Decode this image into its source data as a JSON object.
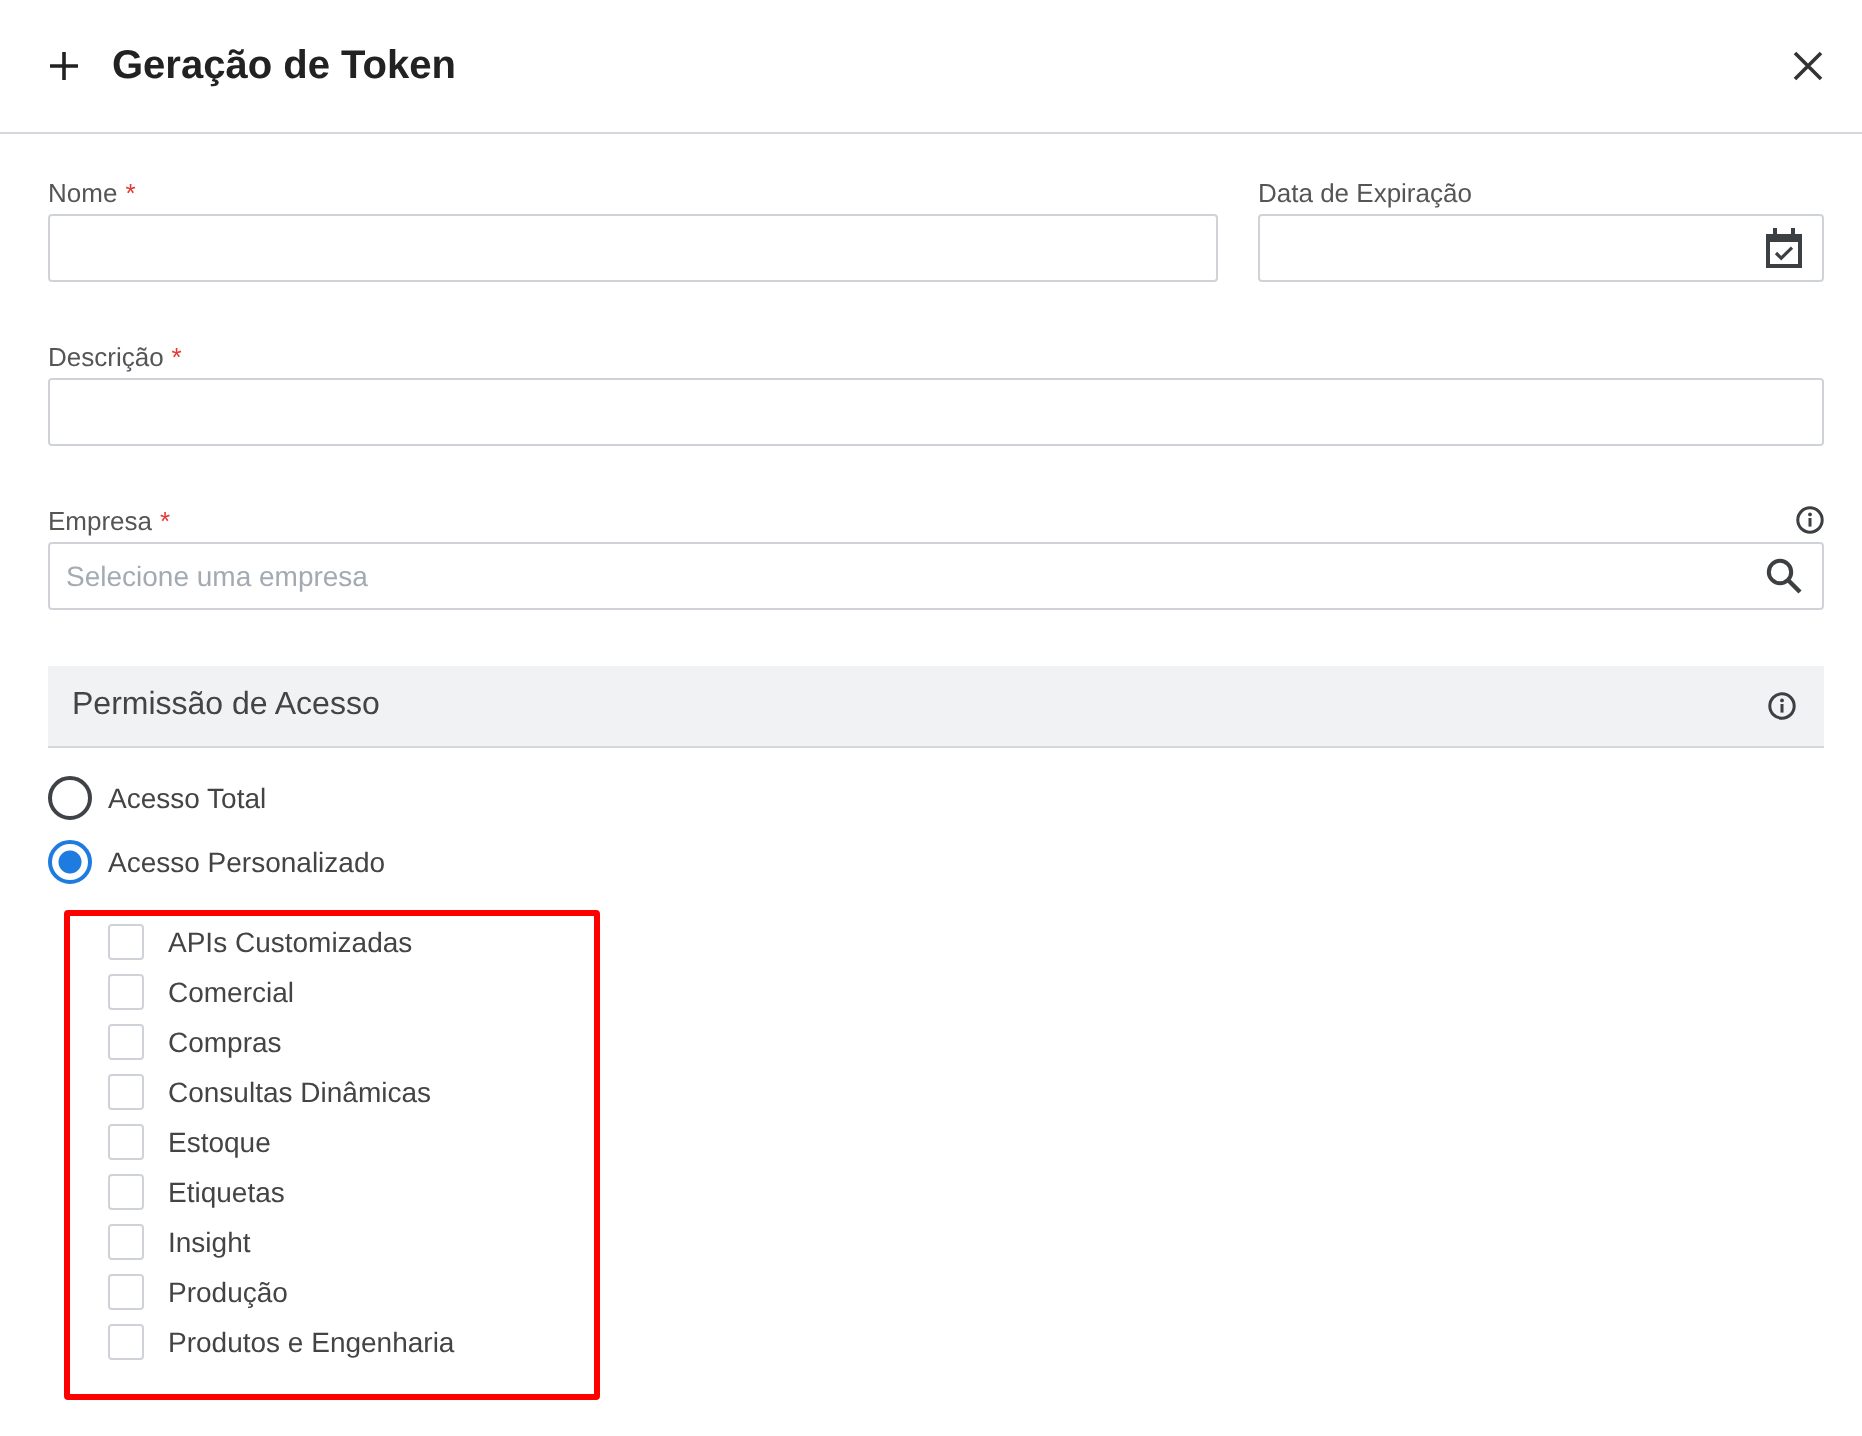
{
  "dialog": {
    "title": "Geração de Token"
  },
  "field_rows": [
    [
      {
        "kind": "text",
        "label": "Nome",
        "required_mark": "*"
      },
      {
        "kind": "date",
        "label": "Data de Expiração"
      }
    ],
    [
      {
        "kind": "text",
        "label": "Descrição",
        "required_mark": "*"
      }
    ],
    [
      {
        "kind": "search",
        "label": "Empresa",
        "required_mark": "*",
        "info": true,
        "placeholder": "Selecione uma empresa"
      }
    ]
  ],
  "section": {
    "title": "Permissão de Acesso",
    "info": true
  },
  "access_options": [
    {
      "label": "Acesso Total",
      "selected": false
    },
    {
      "label": "Acesso Personalizado",
      "selected": true
    }
  ],
  "permissions": {
    "highlighted": true,
    "items": [
      {
        "label": "APIs Customizadas",
        "checked": false
      },
      {
        "label": "Comercial",
        "checked": false
      },
      {
        "label": "Compras",
        "checked": false
      },
      {
        "label": "Consultas Dinâmicas",
        "checked": false
      },
      {
        "label": "Estoque",
        "checked": false
      },
      {
        "label": "Etiquetas",
        "checked": false
      },
      {
        "label": "Insight",
        "checked": false
      },
      {
        "label": "Produção",
        "checked": false
      },
      {
        "label": "Produtos e Engenharia",
        "checked": false
      }
    ]
  }
}
